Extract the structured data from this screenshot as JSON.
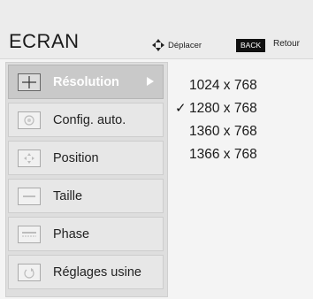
{
  "header": {
    "title": "ECRAN",
    "move_hint": "Déplacer",
    "back_key": "BACK",
    "back_label": "Retour"
  },
  "menu": {
    "items": [
      {
        "label": "Résolution",
        "icon": "resolution-icon",
        "selected": true
      },
      {
        "label": "Config. auto.",
        "icon": "auto-config-icon",
        "selected": false
      },
      {
        "label": "Position",
        "icon": "position-icon",
        "selected": false
      },
      {
        "label": "Taille",
        "icon": "size-icon",
        "selected": false
      },
      {
        "label": "Phase",
        "icon": "phase-icon",
        "selected": false
      },
      {
        "label": "Réglages usine",
        "icon": "factory-reset-icon",
        "selected": false
      }
    ]
  },
  "options": {
    "items": [
      {
        "label": "1024 x 768",
        "checked": false
      },
      {
        "label": "1280 x 768",
        "checked": true
      },
      {
        "label": "1360 x 768",
        "checked": false
      },
      {
        "label": "1366 x 768",
        "checked": false
      }
    ],
    "check_mark": "✓"
  },
  "colors": {
    "header_bg": "#ececec",
    "menu_bg": "#dedede",
    "selected_bg": "#c9c9c9",
    "back_badge_bg": "#111111"
  }
}
